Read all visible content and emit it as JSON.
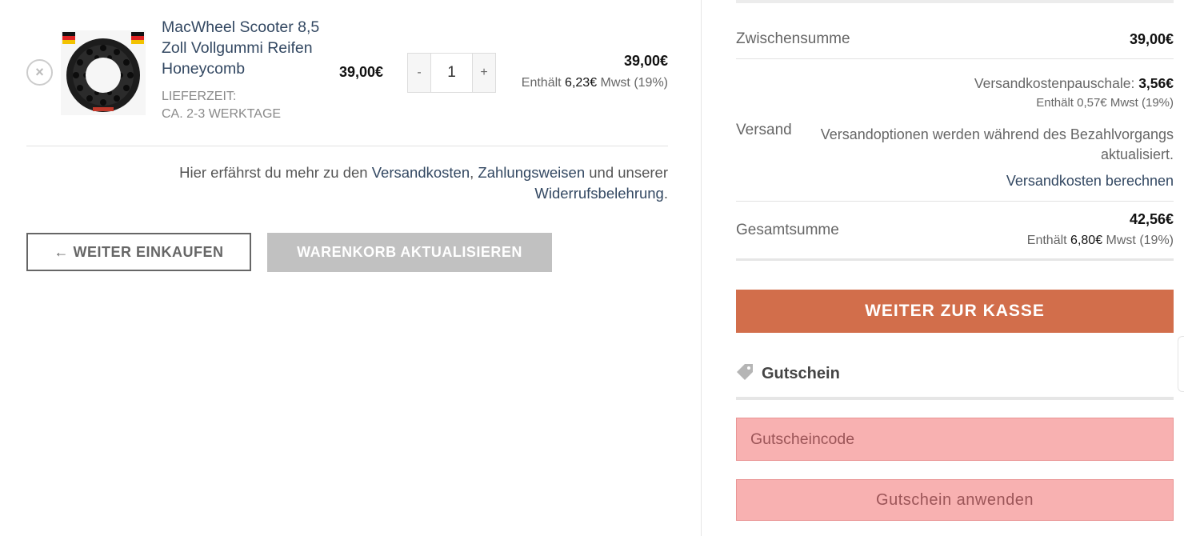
{
  "cart": {
    "remove_symbol": "×",
    "item": {
      "name": "MacWheel Scooter 8,5 Zoll Vollgummi Reifen Honeycomb",
      "delivery_label": "LIEFERZEIT:",
      "delivery_value": "CA. 2-3 WERKTAGE",
      "unit_price": "39,00€",
      "qty_minus": "-",
      "qty_plus": "+",
      "quantity": "1",
      "line_total": "39,00€",
      "tax_prefix": "Enthält",
      "tax_amount": "6,23€",
      "tax_suffix": "Mwst (19%)"
    },
    "info": {
      "prefix": "Hier erfährst du mehr zu den",
      "link_shipping": "Versandkosten",
      "comma": ",",
      "link_payment": "Zahlungsweisen",
      "middle": "und unserer",
      "link_withdrawal": "Widerrufsbelehrung",
      "suffix": "."
    },
    "continue_button": "← WEITER EINKAUFEN",
    "update_button": "WARENKORB AKTUALISIEREN"
  },
  "totals": {
    "subtotal_label": "Zwischensumme",
    "subtotal_value": "39,00€",
    "shipping_label": "Versand",
    "shipping_flat_label": "Versandkostenpauschale:",
    "shipping_flat_value": "3,56€",
    "shipping_tax": "Enthält  0,57€ Mwst (19%)",
    "shipping_note": "Versandoptionen werden während des Bezahlvorgangs aktualisiert.",
    "shipping_calc_link": "Versandkosten berechnen",
    "total_label": "Gesamtsumme",
    "total_value": "42,56€",
    "total_tax_prefix": "Enthält",
    "total_tax_amount": "6,80€",
    "total_tax_suffix": "Mwst (19%)",
    "checkout_button": "WEITER ZUR KASSE"
  },
  "coupon": {
    "title": "Gutschein",
    "icon": "tag-icon",
    "placeholder": "Gutscheincode",
    "apply_button": "Gutschein anwenden"
  },
  "colors": {
    "accent": "#d26e4b",
    "link": "#334862",
    "coupon_error_bg": "#f8b1b1"
  }
}
